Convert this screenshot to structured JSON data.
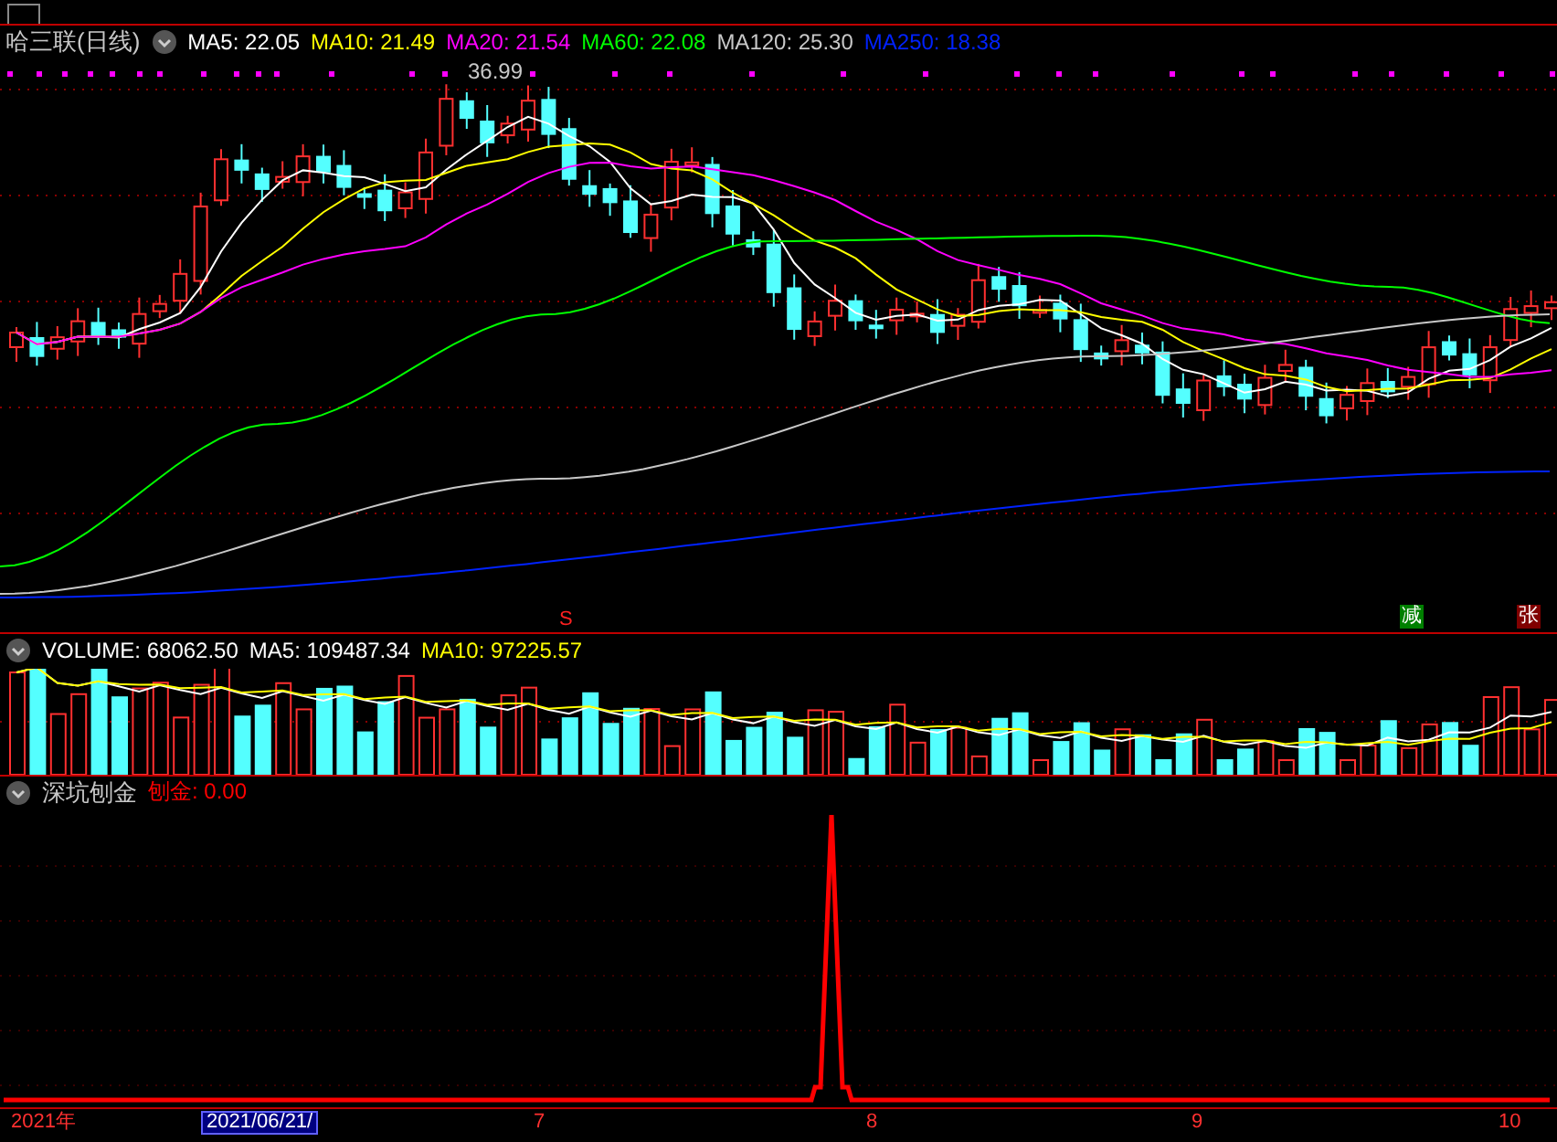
{
  "header": {
    "title": "哈三联(日线)"
  },
  "ma_legend": [
    {
      "label": "MA5: 22.05",
      "color": "#ffffff"
    },
    {
      "label": "MA10: 21.49",
      "color": "#ffff00"
    },
    {
      "label": "MA20: 21.54",
      "color": "#ff00ff"
    },
    {
      "label": "MA60: 22.08",
      "color": "#00ff00"
    },
    {
      "label": "MA120: 25.30",
      "color": "#c8c8c8"
    },
    {
      "label": "MA250: 18.38",
      "color": "#0022ff"
    }
  ],
  "price_chart": {
    "high_label": "36.99",
    "signals": [
      {
        "text": "S",
        "kind": "sell"
      },
      {
        "text": "减",
        "kind": "reduce"
      },
      {
        "text": "张",
        "kind": "rise"
      }
    ]
  },
  "volume_panel": {
    "legend": [
      {
        "label": "VOLUME: 68062.50",
        "color": "#ffffff"
      },
      {
        "label": "MA5: 109487.34",
        "color": "#ffffff"
      },
      {
        "label": "MA10: 97225.57",
        "color": "#ffff00"
      }
    ]
  },
  "indicator_panel": {
    "name": "深坑刨金",
    "legend": [
      {
        "label": "刨金: 0.00",
        "color": "#ff0000"
      }
    ]
  },
  "time_axis": [
    {
      "label": "2021年",
      "selected": false
    },
    {
      "label": "2021/06/21/",
      "selected": true
    },
    {
      "label": "7",
      "selected": false
    },
    {
      "label": "8",
      "selected": false
    },
    {
      "label": "9",
      "selected": false
    },
    {
      "label": "10",
      "selected": false
    }
  ]
}
